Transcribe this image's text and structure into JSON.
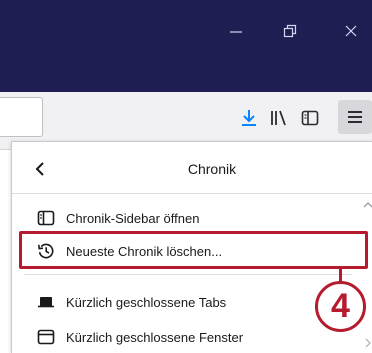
{
  "window": {
    "controls": [
      "minimize",
      "restore",
      "close"
    ]
  },
  "toolbar": {
    "icons": [
      "download-icon",
      "library-icon",
      "sidebar-icon",
      "hamburger-menu-icon"
    ]
  },
  "panel": {
    "title": "Chronik",
    "items": [
      {
        "label": "Chronik-Sidebar öffnen",
        "icon": "sidebar-panel-icon"
      },
      {
        "label": "Neueste Chronik löschen...",
        "icon": "history-clock-icon"
      },
      {
        "label": "Kürzlich geschlossene Tabs",
        "icon": "tab-icon"
      },
      {
        "label": "Kürzlich geschlossene Fenster",
        "icon": "window-icon"
      }
    ]
  },
  "annotation": {
    "step_number": "4"
  },
  "colors": {
    "titlebar": "#1f1e53",
    "highlight": "#b51a2e",
    "download_accent": "#0a84ff"
  }
}
